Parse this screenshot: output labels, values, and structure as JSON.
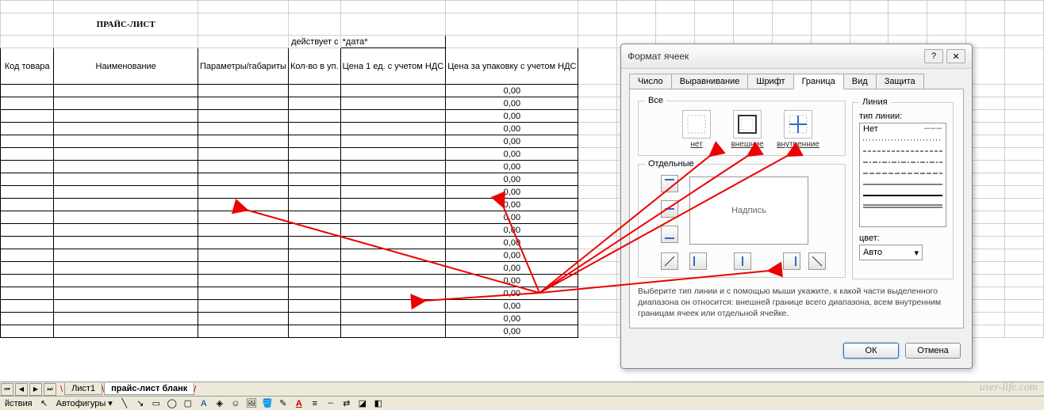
{
  "sheet": {
    "title": "ПРАЙС-ЛИСТ",
    "valid_from_label": "действует с",
    "date_placeholder": "*дата*",
    "headers": {
      "code": "Код товара",
      "name": "Наименование",
      "params": "Параметры/габариты",
      "qty": "Кол-во в уп.",
      "price1": "Цена 1 ед. с учетом НДС",
      "price_pack": "Цена за упаковку с учетом НДС"
    },
    "value_zero": "0,00",
    "data_rows": 20
  },
  "tabs": {
    "nav": {
      "first": "⏮",
      "prev": "◀",
      "next": "▶",
      "last": "⏭"
    },
    "items": [
      "Лист1",
      "прайс-лист бланк"
    ],
    "active": 1
  },
  "drawbar": {
    "actions_label": "йствия",
    "autoshapes_label": "Автофигуры"
  },
  "dialog": {
    "title": "Формат ячеек",
    "help": "?",
    "close": "✕",
    "tabs": [
      "Число",
      "Выравнивание",
      "Шрифт",
      "Граница",
      "Вид",
      "Защита"
    ],
    "active_tab": 3,
    "group_all": "Все",
    "group_individual": "Отдельные",
    "group_line": "Линия",
    "presets": {
      "none": "нет",
      "outer": "внешние",
      "inner": "внутренние"
    },
    "preview_label": "Надпись",
    "line_type_label": "тип линии:",
    "line_none": "Нет",
    "color_label": "цвет:",
    "color_value": "Авто",
    "hint": "Выберите тип линии и с помощью мыши укажите, к какой части выделенного диапазона он относится: внешней границе всего диапазона, всем внутренним границам ячеек или отдельной ячейке.",
    "ok": "ОК",
    "cancel": "Отмена"
  },
  "watermark": "user-life.com"
}
